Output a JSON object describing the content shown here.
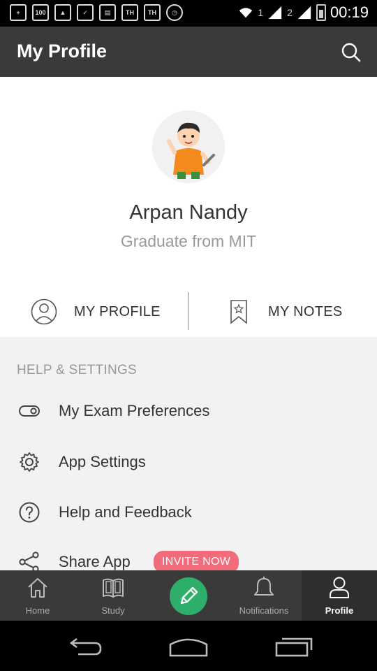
{
  "status_bar": {
    "time": "00:19",
    "sim1": "1",
    "sim2": "2",
    "left_icons": [
      "add-icon",
      "battery-100-icon",
      "image-icon",
      "battery-check-icon",
      "news-icon",
      "th-icon",
      "th-icon",
      "sync-clock-icon"
    ]
  },
  "app_bar": {
    "title": "My Profile"
  },
  "profile": {
    "name": "Arpan Nandy",
    "subtitle": "Graduate from MIT",
    "tabs": [
      {
        "label": "MY PROFILE",
        "icon": "user-circle-icon"
      },
      {
        "label": "MY NOTES",
        "icon": "bookmark-star-icon"
      }
    ]
  },
  "settings": {
    "section_title": "HELP & SETTINGS",
    "items": [
      {
        "label": "My Exam Preferences",
        "icon": "toggle-icon"
      },
      {
        "label": "App Settings",
        "icon": "gear-icon"
      },
      {
        "label": "Help and Feedback",
        "icon": "help-circle-icon"
      },
      {
        "label": "Share App",
        "icon": "share-icon",
        "badge": "INVITE NOW"
      }
    ]
  },
  "bottom_nav": {
    "items": [
      {
        "label": "Home",
        "icon": "home-icon"
      },
      {
        "label": "Study",
        "icon": "book-icon"
      },
      {
        "label": "",
        "icon": "pencil-icon"
      },
      {
        "label": "Notifications",
        "icon": "bell-icon"
      },
      {
        "label": "Profile",
        "icon": "user-icon",
        "active": true
      }
    ]
  },
  "colors": {
    "app_bar": "#3a3a3a",
    "accent_green": "#2eae6b",
    "badge_pink": "#f26b7a",
    "settings_bg": "#f2f2f2"
  }
}
